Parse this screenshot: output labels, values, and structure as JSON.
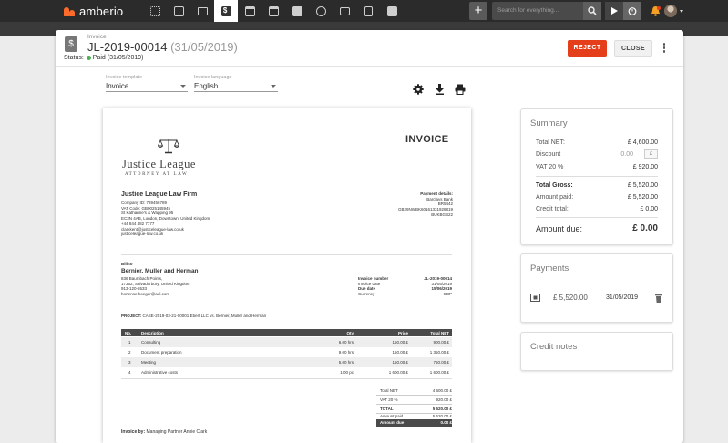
{
  "app": {
    "brand": "amberio"
  },
  "topbar": {
    "nav_icons": [
      "dashboard-icon",
      "contacts-icon",
      "briefcase-icon",
      "invoice-icon",
      "bank-icon",
      "calendar-icon",
      "tasks-icon",
      "clock-icon",
      "folder-icon",
      "documents-icon",
      "reports-icon"
    ],
    "active_nav": "invoice-icon",
    "search_placeholder": "Search for everything...",
    "plus_label": "+"
  },
  "header": {
    "type_label": "Invoice",
    "number": "JL-2019-00014",
    "date": "(31/05/2019)",
    "status_label": "Status:",
    "status_value": "Paid (31/05/2019)",
    "status_color": "#4caf50",
    "reject_label": "REJECT",
    "close_label": "CLOSE",
    "reject_color": "#e53e1a"
  },
  "options": {
    "template_label": "Invoice template",
    "template_value": "Invoice",
    "language_label": "Invoice language",
    "language_value": "English"
  },
  "document": {
    "title": "INVOICE",
    "logo_name": "Justice League",
    "logo_tagline": "ATTORNEY AT LAW",
    "firm_name": "Justice League Law Firm",
    "firm_lines": [
      "Company ID: 789456789",
      "VAT Code: GB0025145945",
      "St Katharine's & Wapping 95",
      "EC3N 4AB, London, Downtown, United Kingdom",
      "+44 844 482 7777",
      "clarkkent@justiceleague-law.co.uk",
      "justiceleague-law.co.uk"
    ],
    "payment_title": "Payment details:",
    "payment_lines": [
      "Barclays Bank",
      "BR5442",
      "GB29NWBK60161331926819",
      "BUKBGB22"
    ],
    "bill_to_label": "Bill to",
    "client_name": "Bernier, Muller and Herman",
    "client_lines": [
      "836 Baumbach Points,",
      "17352, Salvadorbury, United Kingdom",
      "913-120-5533",
      "hortense.hoeger@aol.com"
    ],
    "meta": [
      {
        "label": "Invoice number",
        "value": "JL-2019-00014",
        "bold": true
      },
      {
        "label": "Invoice date",
        "value": "31/05/2019",
        "bold": false
      },
      {
        "label": "Due date",
        "value": "15/06/2019",
        "bold": true
      },
      {
        "label": "Currency",
        "value": "GBP",
        "bold": false
      }
    ],
    "project_label": "PROJECT:",
    "project_value": "CASE-2019-03-21-00001  Ebert LLC vs. Bernier, Muller and Herman",
    "columns": {
      "no": "No.",
      "desc": "Description",
      "qty": "Qty",
      "price": "Price",
      "total": "Total NET"
    },
    "items": [
      {
        "no": "1",
        "desc": "Consulting",
        "qty": "6.00 hrs",
        "price": "150.00 £",
        "total": "900.00 £"
      },
      {
        "no": "2",
        "desc": "Document preparation",
        "qty": "9.00 hrs",
        "price": "150.00 £",
        "total": "1 350.00 £"
      },
      {
        "no": "3",
        "desc": "Meeting",
        "qty": "5.00 hrs",
        "price": "150.00 £",
        "total": "750.00 £"
      },
      {
        "no": "4",
        "desc": "Administrative costs",
        "qty": "1.00 pc",
        "price": "1 600.00 £",
        "total": "1 600.00 £"
      }
    ],
    "totals": [
      {
        "label": "Total NET",
        "value": "4 600.00 £"
      },
      {
        "label": "VAT 20 %",
        "value": "920.00 £"
      },
      {
        "label": "TOTAL",
        "value": "5 520.00 £"
      },
      {
        "label": "Amount paid",
        "value": "5 520.00 £"
      },
      {
        "label": "Amount due",
        "value": "0.00 £"
      }
    ],
    "invoice_by_label": "Invoice by:",
    "invoice_by_value": "Managing Partner Annie Clark"
  },
  "summary": {
    "title": "Summary",
    "rows": [
      {
        "label": "Total NET:",
        "value": "£ 4,600.00"
      },
      {
        "label": "Discount",
        "value": "0.00"
      },
      {
        "label": "VAT 20 %",
        "value": "£ 920.00"
      },
      {
        "label": "Total Gross:",
        "value": "£ 5,520.00"
      },
      {
        "label": "Amount paid:",
        "value": "£ 5,520.00"
      },
      {
        "label": "Credit total:",
        "value": "£ 0.00"
      }
    ],
    "discount_unit": "£",
    "amount_due_label": "Amount due:",
    "amount_due_value": "£ 0.00"
  },
  "payments": {
    "title": "Payments",
    "amount": "£ 5,520.00",
    "date": "31/05/2019"
  },
  "credit_notes": {
    "title": "Credit notes"
  }
}
